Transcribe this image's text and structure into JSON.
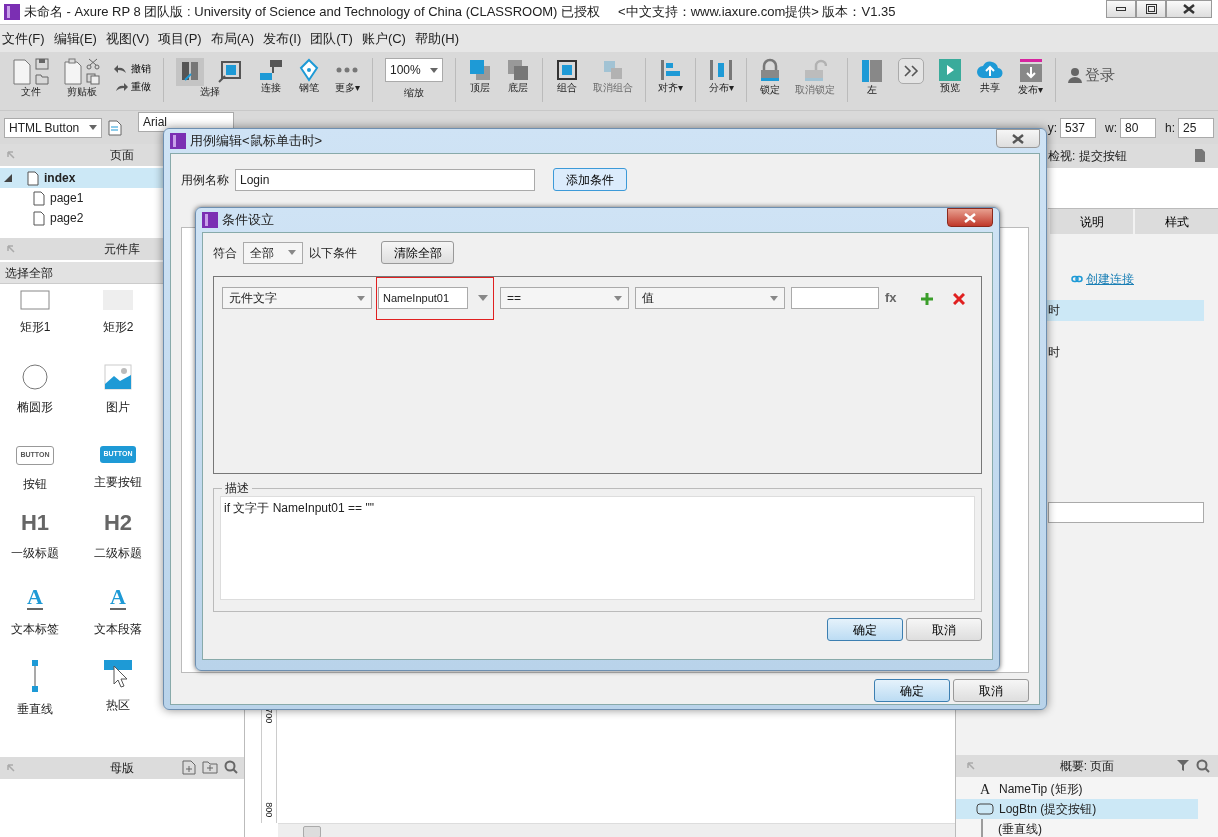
{
  "window": {
    "title": "未命名 - Axure RP 8 团队版 : University of Science and Technology of China (CLASSROOM) 已授权",
    "title_extra": "<中文支持：www.iaxure.com提供> 版本：V1.35"
  },
  "menu": [
    "文件(F)",
    "编辑(E)",
    "视图(V)",
    "项目(P)",
    "布局(A)",
    "发布(I)",
    "团队(T)",
    "账户(C)",
    "帮助(H)"
  ],
  "toolbar_groups": [
    {
      "items": [
        {
          "kind": "file",
          "label": "文件",
          "disabled": false
        },
        {
          "kind": "clipboard",
          "label": "剪贴板",
          "disabled": false
        },
        {
          "kind": "history",
          "labels": [
            "撤销",
            "重做"
          ],
          "disabled": false
        }
      ]
    },
    {
      "items": [
        {
          "kind": "select",
          "label": "选择",
          "disabled": false
        },
        {
          "kind": "connect",
          "label": "连接",
          "disabled": false
        },
        {
          "kind": "pen",
          "label": "钢笔",
          "disabled": false
        },
        {
          "kind": "more",
          "label": "更多▾",
          "disabled": false
        }
      ]
    },
    {
      "items": [
        {
          "kind": "zoom",
          "label": "缩放",
          "value": "100%",
          "disabled": false
        }
      ]
    },
    {
      "items": [
        {
          "kind": "front",
          "label": "顶层",
          "disabled": false
        },
        {
          "kind": "back",
          "label": "底层",
          "disabled": false
        }
      ]
    },
    {
      "items": [
        {
          "kind": "group",
          "label": "组合",
          "disabled": false
        },
        {
          "kind": "ungroup",
          "label": "取消组合",
          "disabled": true
        }
      ]
    },
    {
      "items": [
        {
          "kind": "align",
          "label": "对齐▾",
          "disabled": false
        }
      ]
    },
    {
      "items": [
        {
          "kind": "distribute",
          "label": "分布▾",
          "disabled": false
        }
      ]
    },
    {
      "items": [
        {
          "kind": "lock",
          "label": "锁定",
          "disabled": false
        },
        {
          "kind": "unlock",
          "label": "取消锁定",
          "disabled": true
        }
      ]
    },
    {
      "items": [
        {
          "kind": "left",
          "label": "左",
          "disabled": false
        },
        {
          "kind": "expand",
          "disabled": false
        },
        {
          "kind": "preview",
          "label": "预览",
          "disabled": false
        },
        {
          "kind": "share",
          "label": "共享",
          "disabled": false
        },
        {
          "kind": "publish",
          "label": "发布▾",
          "disabled": false
        }
      ]
    },
    {
      "items": [
        {
          "kind": "login",
          "label": "登录",
          "disabled": false
        }
      ]
    }
  ],
  "format_bar": {
    "widget_type": "HTML Button",
    "font": "Arial",
    "coords": [
      {
        "label": "y:",
        "value": "537"
      },
      {
        "label": "w:",
        "value": "80"
      },
      {
        "label": "h:",
        "value": "25"
      }
    ]
  },
  "pages": {
    "title": "页面",
    "tree": [
      {
        "label": "index",
        "expanded": true,
        "selected": true,
        "children": [
          {
            "label": "page1",
            "selected": false
          },
          {
            "label": "page2",
            "selected": false
          }
        ]
      }
    ]
  },
  "library": {
    "title": "元件库",
    "filter": "选择全部",
    "widgets": [
      {
        "kind": "rect1",
        "label": "矩形1"
      },
      {
        "kind": "rect2",
        "label": "矩形2"
      },
      {
        "kind": "ellipse",
        "label": "椭圆形"
      },
      {
        "kind": "image",
        "label": "图片"
      },
      {
        "kind": "button",
        "label": "按钮",
        "glyph": "BUTTON"
      },
      {
        "kind": "primary",
        "label": "主要按钮",
        "glyph": "BUTTON"
      },
      {
        "kind": "heading",
        "label": "一级标题",
        "glyph": "H1"
      },
      {
        "kind": "heading",
        "label": "二级标题",
        "glyph": "H2"
      },
      {
        "kind": "label",
        "label": "文本标签",
        "glyph": "A"
      },
      {
        "kind": "paragraph",
        "label": "文本段落",
        "glyph": "A"
      },
      {
        "kind": "vline",
        "label": "垂直线"
      },
      {
        "kind": "hotspot",
        "label": "热区"
      }
    ]
  },
  "masters": {
    "title": "母版"
  },
  "canvas": {
    "ruler_labels": [
      "700",
      "800"
    ]
  },
  "inspector": {
    "title": "检视: 提交按钮",
    "tabs": [
      {
        "label": "说明",
        "selected": false
      },
      {
        "label": "样式",
        "selected": false
      }
    ],
    "link": "创建连接",
    "events": [
      {
        "label": "时",
        "selected": true
      },
      {
        "label": "时",
        "selected": false
      }
    ]
  },
  "outline": {
    "title": "概要: 页面",
    "items": [
      {
        "kind": "text",
        "glyph": "A",
        "label": "NameTip (矩形)",
        "selected": false
      },
      {
        "kind": "button",
        "label": "LogBtn (提交按钮)",
        "selected": true
      },
      {
        "kind": "line",
        "label": "(垂直线)",
        "selected": false
      }
    ]
  },
  "case_dialog": {
    "title": "用例编辑<鼠标单击时>",
    "name_label": "用例名称",
    "name": "Login",
    "add_condition": "添加条件",
    "ok": "确定",
    "cancel": "取消"
  },
  "condition_dialog": {
    "title": "条件设立",
    "match_label": "符合",
    "match_value": "全部",
    "match_suffix": "以下条件",
    "clear_all": "清除全部",
    "conditions": [
      {
        "source": "元件文字",
        "target": "NameInput01",
        "target_highlighted": true,
        "operator": "==",
        "value_type": "值",
        "fx": "fx"
      }
    ],
    "description_label": "描述",
    "description": "if 文字于 NameInput01 == \"\"",
    "ok": "确定",
    "cancel": "取消"
  }
}
